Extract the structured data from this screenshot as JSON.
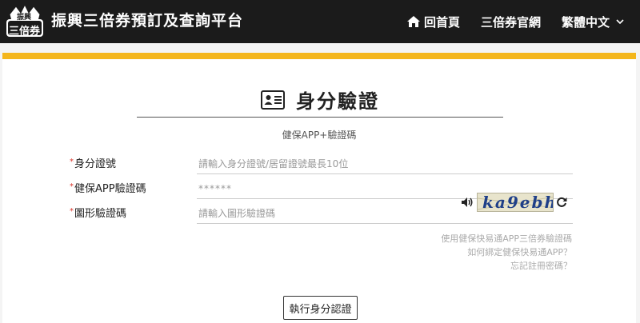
{
  "header": {
    "logo_text_top": "振興",
    "logo_text_bottom": "三倍券",
    "site_title": "振興三倍券預訂及查詢平台",
    "nav": {
      "home": "回首頁",
      "official": "三倍券官網",
      "language": "繁體中文"
    }
  },
  "main": {
    "title": "身分驗證",
    "subtitle": "健保APP+驗證碼",
    "form": {
      "required_mark": "*",
      "id_label": "身分證號",
      "id_placeholder": "請輸入身分證號/居留證號最長10位",
      "app_code_label": "健保APP驗證碼",
      "app_code_placeholder": "******",
      "captcha_label": "圖形驗證碼",
      "captcha_placeholder": "請輸入圖形驗證碼",
      "captcha_text": "ka9ebh"
    },
    "links": [
      "使用健保快易通APP三倍券驗證碼",
      "如何綁定健保快易通APP？",
      "忘記註冊密碼？"
    ],
    "submit_label": "執行身分認證"
  },
  "colors": {
    "header_bg": "#1b1b1b",
    "accent": "#f4b61c",
    "required": "#d9342b"
  }
}
